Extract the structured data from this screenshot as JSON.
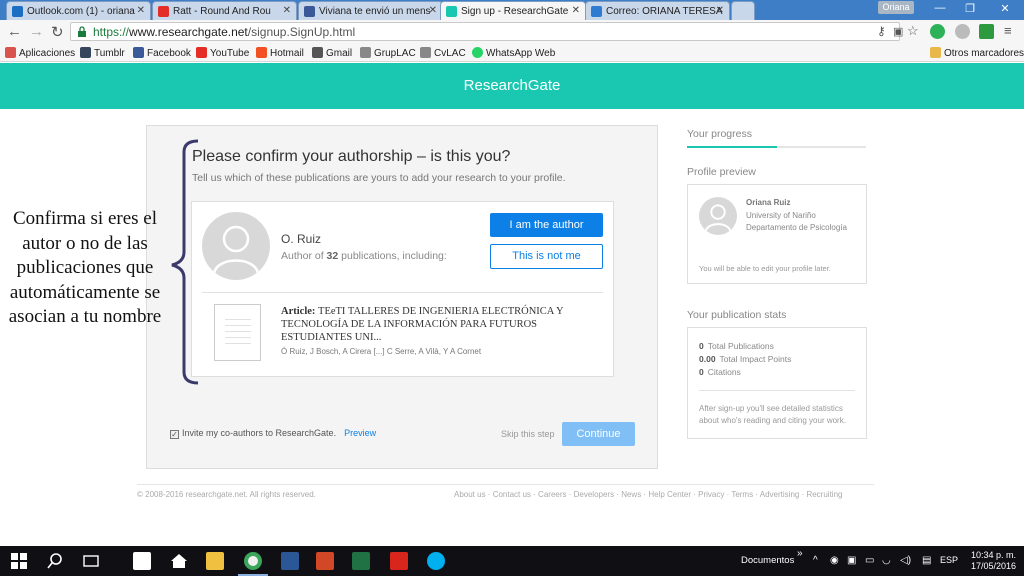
{
  "browser": {
    "tabs": [
      {
        "label": "Outlook.com (1) - oriana",
        "icon": "outlook-icon",
        "color": "#1b6ec2"
      },
      {
        "label": "Ratt - Round And Rou",
        "icon": "youtube-icon",
        "color": "#e52d27"
      },
      {
        "label": "Viviana te envió un mens",
        "icon": "facebook-icon",
        "color": "#3b5998"
      },
      {
        "label": "Sign up - ResearchGate",
        "icon": "researchgate-icon",
        "color": "#1ac8b1",
        "active": true
      },
      {
        "label": "Correo: ORIANA TERESA",
        "icon": "mail-icon",
        "color": "#2f7bd2"
      }
    ],
    "profile_name": "Oriana",
    "url_secure": "https://",
    "url_host": "www.researchgate.net",
    "url_path": "/signup.SignUp.html",
    "bookmarks": [
      {
        "label": "Aplicaciones",
        "icon": "apps-icon",
        "color": "#d9534f"
      },
      {
        "label": "Tumblr",
        "icon": "tumblr-icon",
        "color": "#35465c"
      },
      {
        "label": "Facebook",
        "icon": "facebook-icon",
        "color": "#3b5998"
      },
      {
        "label": "YouTube",
        "icon": "youtube-icon",
        "color": "#e52d27"
      },
      {
        "label": "Hotmail",
        "icon": "hotmail-icon",
        "color": "#f25022"
      },
      {
        "label": "Gmail",
        "icon": "gmail-icon",
        "color": "#555555"
      },
      {
        "label": "GrupLAC",
        "icon": "gruplac-icon",
        "color": "#888888"
      },
      {
        "label": "CvLAC",
        "icon": "cvlac-icon",
        "color": "#888888"
      },
      {
        "label": "WhatsApp Web",
        "icon": "whatsapp-icon",
        "color": "#25d366"
      }
    ],
    "other_bookmarks": "Otros marcadores"
  },
  "header": {
    "brand": "ResearchGate"
  },
  "confirm": {
    "title": "Please confirm your authorship – is this you?",
    "subtitle": "Tell us which of these publications are yours to add your research to your profile.",
    "author_name": "O. Ruiz",
    "author_count_prefix": "Author of ",
    "author_count": "32",
    "author_count_suffix": " publications, including:",
    "btn_author": "I am the author",
    "btn_not_me": "This is not me",
    "publication": {
      "type": "Article: ",
      "title": "TEeTI TALLERES DE INGENIERIA ELECTRÓNICA Y TECNOLOGÍA DE LA INFORMACIÓN PARA FUTUROS ESTUDIANTES UNI...",
      "authors": "Ó Ruiz, J Bosch, A Cirera [...] C Serre, A Vilà, Y A Cornet"
    },
    "invite_label": "Invite my co-authors to ResearchGate.",
    "invite_preview": "Preview",
    "skip": "Skip this step",
    "continue": "Continue"
  },
  "sidebar": {
    "progress_label": "Your progress",
    "progress_fraction": 0.5,
    "preview_label": "Profile preview",
    "preview": {
      "name": "Oriana Ruiz",
      "university": "University of Nariño",
      "department": "Departamento de Psicología",
      "note": "You will be able to edit your profile later."
    },
    "stats_label": "Your publication stats",
    "stats": [
      {
        "value": "0",
        "label": "Total Publications"
      },
      {
        "value": "0.00",
        "label": "Total Impact Points"
      },
      {
        "value": "0",
        "label": "Citations"
      }
    ],
    "stats_note": "After sign-up you'll see detailed statistics about who's reading and citing your work."
  },
  "footer": {
    "copyright": "© 2008-2016 researchgate.net. All rights reserved.",
    "links": [
      "About us",
      "Contact us",
      "Careers",
      "Developers",
      "News",
      "Help Center",
      "Privacy",
      "Terms",
      "Advertising",
      "Recruiting"
    ]
  },
  "annotation": "Confirma si eres el autor o no de las publicaciones que automáticamente se asocian a tu nombre",
  "taskbar": {
    "docs_label": "Documentos",
    "lang": "ESP",
    "time": "10:34 p. m.",
    "date": "17/05/2016"
  }
}
